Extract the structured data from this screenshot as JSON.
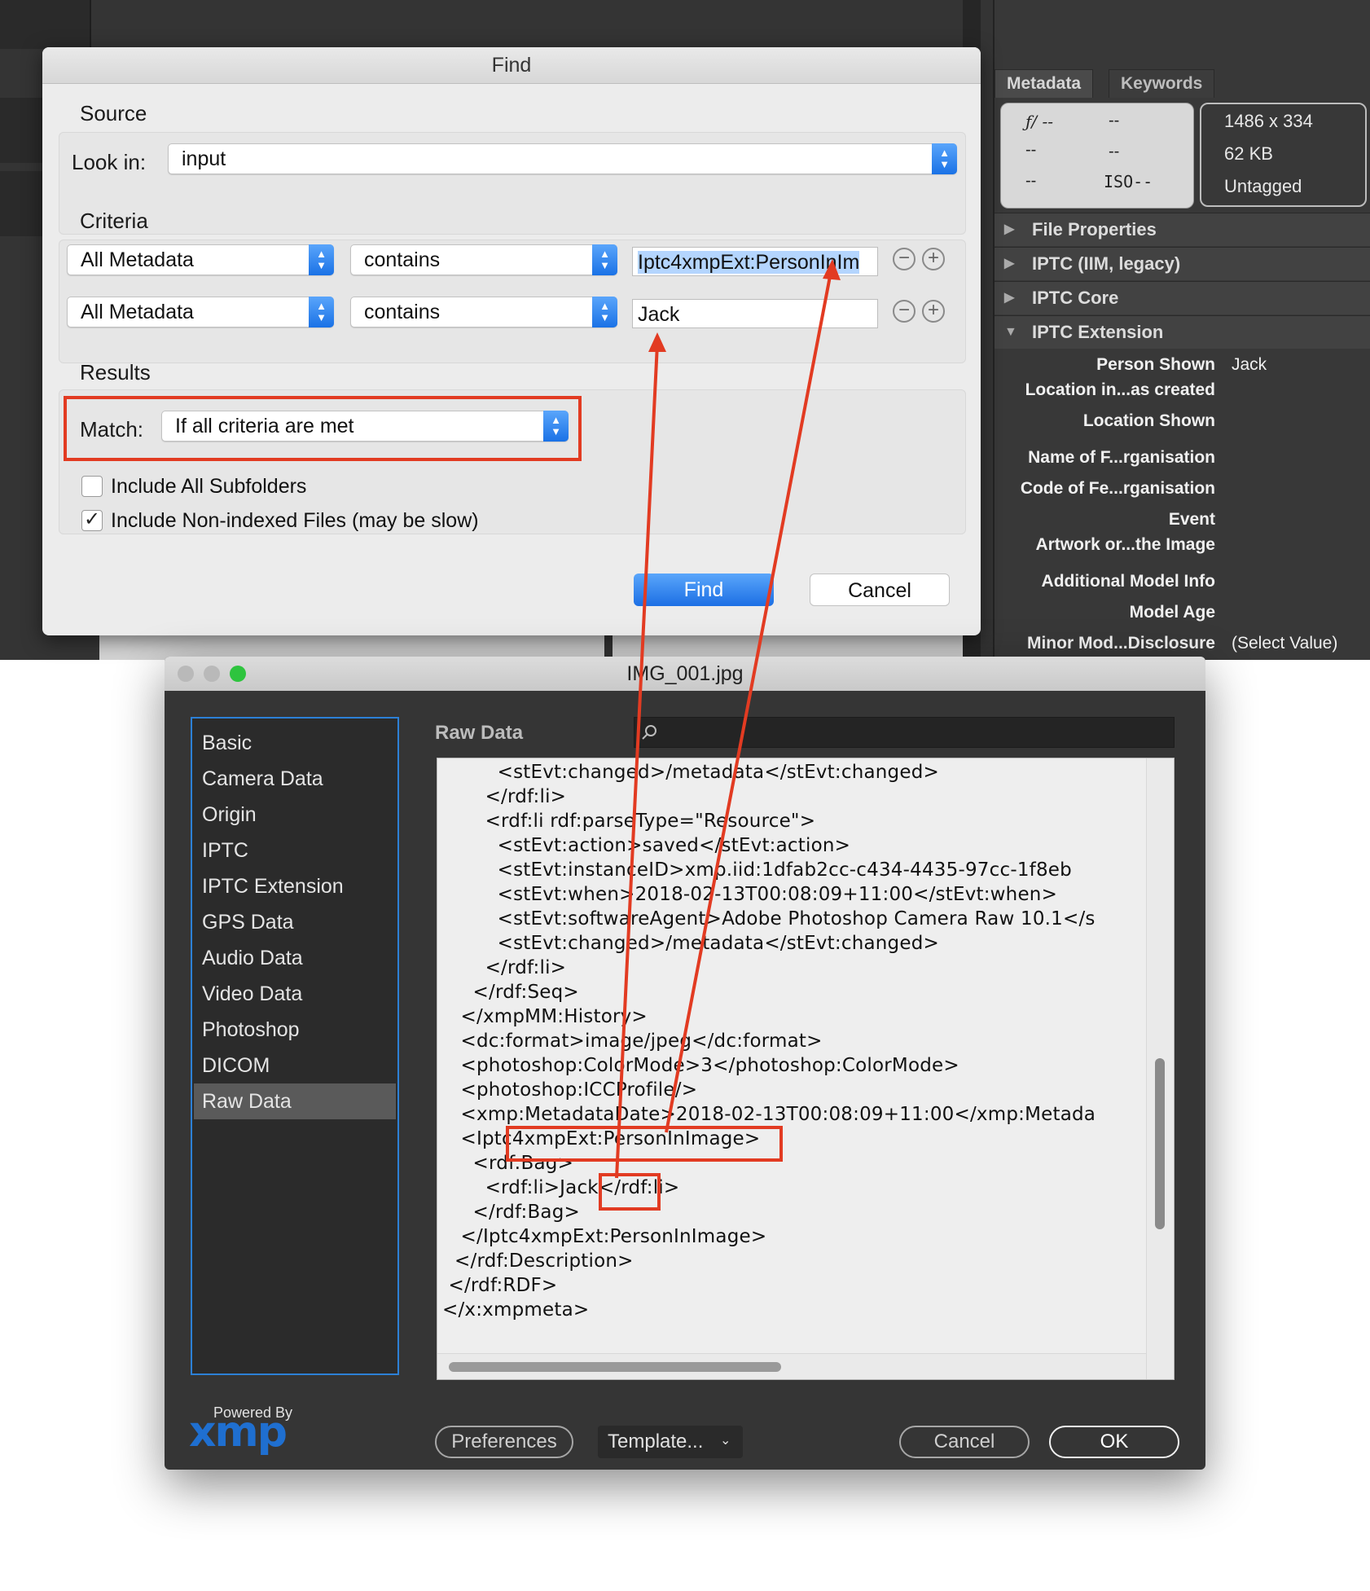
{
  "metadata_panel": {
    "tabs": [
      "Metadata",
      "Keywords"
    ],
    "camera": {
      "aperture": "ƒ/ --",
      "shutter": "--",
      "r2c1": "--",
      "r2c2": "--",
      "r3c1": "--",
      "iso": "ISO--"
    },
    "file_info": {
      "dimensions": "1486 x 334",
      "size": "62 KB",
      "color": "Untagged"
    },
    "sections": [
      "File Properties",
      "IPTC (IIM, legacy)",
      "IPTC Core",
      "IPTC Extension"
    ],
    "iptc_extension_fields": [
      {
        "label": "Person Shown",
        "value": "Jack"
      },
      {
        "label": "Location in...as created",
        "value": ""
      },
      {
        "label": "Location Shown",
        "value": ""
      },
      {
        "label": "Name of F...rganisation",
        "value": ""
      },
      {
        "label": "Code of Fe...rganisation",
        "value": ""
      },
      {
        "label": "Event",
        "value": ""
      },
      {
        "label": "Artwork or...the Image",
        "value": ""
      },
      {
        "label": "Additional Model Info",
        "value": ""
      },
      {
        "label": "Model Age",
        "value": ""
      },
      {
        "label": "Minor Mod...Disclosure",
        "value": "(Select Value)"
      }
    ]
  },
  "find_dialog": {
    "title": "Find",
    "source_label": "Source",
    "look_in_label": "Look in:",
    "look_in_value": "input",
    "criteria_label": "Criteria",
    "criteria": [
      {
        "field": "All Metadata",
        "op": "contains",
        "value": "Iptc4xmpExt:PersonInIm"
      },
      {
        "field": "All Metadata",
        "op": "contains",
        "value": "Jack"
      }
    ],
    "results_label": "Results",
    "match_label": "Match:",
    "match_value": "If all criteria are met",
    "include_subfolders": "Include All Subfolders",
    "include_nonindexed": "Include Non-indexed Files (may be slow)",
    "check_mark": "✓",
    "find_button": "Find",
    "cancel_button": "Cancel"
  },
  "xmp_dialog": {
    "title": "IMG_001.jpg",
    "nav_items": [
      "Basic",
      "Camera Data",
      "Origin",
      "IPTC",
      "IPTC Extension",
      "GPS Data",
      "Audio Data",
      "Video Data",
      "Photoshop",
      "DICOM",
      "Raw Data"
    ],
    "selected_nav": "Raw Data",
    "panel_title": "Raw Data",
    "raw_lines": [
      "         <stEvt:changed>/metadata</stEvt:changed>",
      "       </rdf:li>",
      "       <rdf:li rdf:parseType=\"Resource\">",
      "         <stEvt:action>saved</stEvt:action>",
      "         <stEvt:instanceID>xmp.iid:1dfab2cc-c434-4435-97cc-1f8eb",
      "         <stEvt:when>2018-02-13T00:08:09+11:00</stEvt:when>",
      "         <stEvt:softwareAgent>Adobe Photoshop Camera Raw 10.1</s",
      "         <stEvt:changed>/metadata</stEvt:changed>",
      "       </rdf:li>",
      "     </rdf:Seq>",
      "   </xmpMM:History>",
      "   <dc:format>image/jpeg</dc:format>",
      "   <photoshop:ColorMode>3</photoshop:ColorMode>",
      "   <photoshop:ICCProfile/>",
      "   <xmp:MetadataDate>2018-02-13T00:08:09+11:00</xmp:Metada",
      "   <Iptc4xmpExt:PersonInImage>",
      "     <rdf:Bag>",
      "       <rdf:li>Jack</rdf:li>",
      "     </rdf:Bag>",
      "   </Iptc4xmpExt:PersonInImage>",
      "  </rdf:Description>",
      " </rdf:RDF>",
      "</x:xmpmeta>"
    ],
    "powered_by": "Powered By",
    "xmp_logo": "xmp",
    "preferences_button": "Preferences",
    "template_button": "Template...",
    "cancel_button": "Cancel",
    "ok_button": "OK"
  },
  "colors": {
    "annotation_red": "#e23b22",
    "accent_blue": "#1a72e6",
    "xmp_logo_blue": "#1f6fd0"
  }
}
